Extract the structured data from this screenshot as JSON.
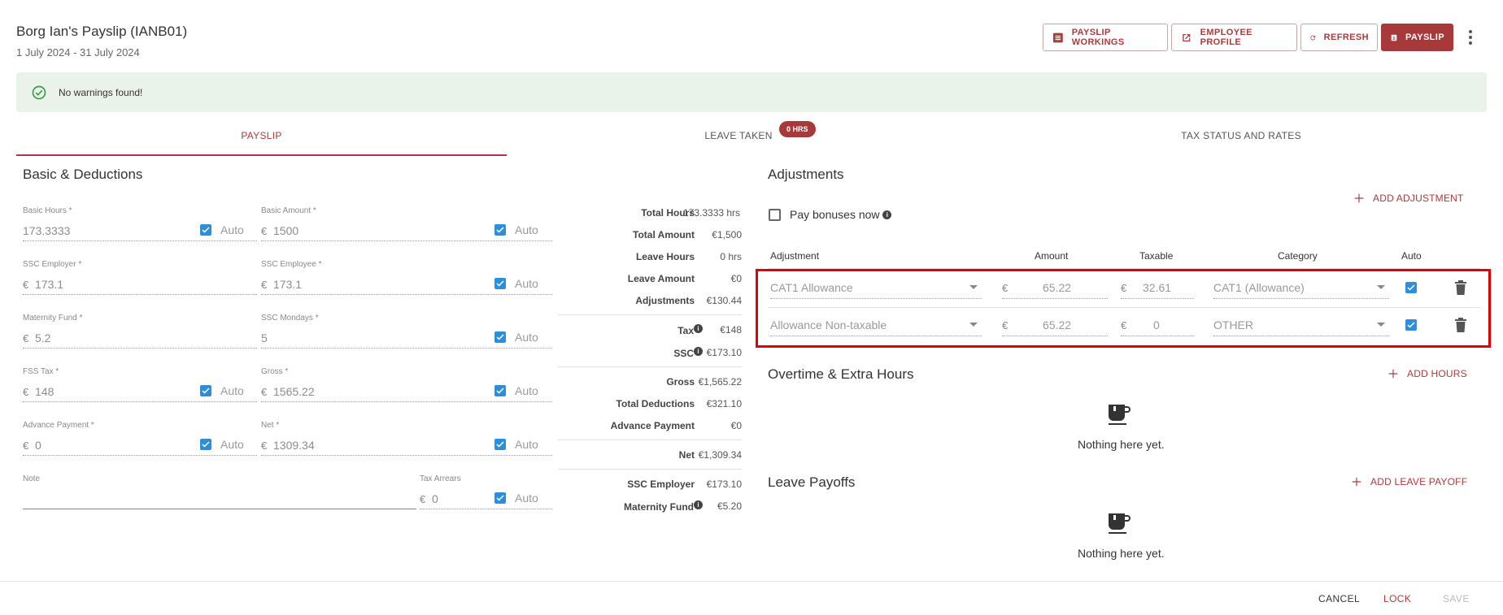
{
  "header": {
    "title": "Borg Ian's Payslip (IANB01)",
    "period": "1 July 2024 - 31 July 2024",
    "buttons": {
      "payslip_workings": "PAYSLIP WORKINGS",
      "employee_profile": "EMPLOYEE PROFILE",
      "refresh": "REFRESH",
      "payslip": "PAYSLIP"
    }
  },
  "banner": {
    "text": "No warnings found!"
  },
  "tabs": [
    {
      "label": "PAYSLIP",
      "active": true
    },
    {
      "label": "LEAVE TAKEN",
      "badge": "0 HRS"
    },
    {
      "label": "TAX STATUS AND RATES"
    }
  ],
  "basic": {
    "title": "Basic & Deductions",
    "auto_label": "Auto",
    "currency": "€",
    "fields": {
      "basic_hours": {
        "label": "Basic Hours *",
        "value": "173.3333"
      },
      "basic_amount": {
        "label": "Basic Amount *",
        "value": "1500"
      },
      "ssc_employer": {
        "label": "SSC Employer *",
        "value": "173.1"
      },
      "ssc_employee": {
        "label": "SSC Employee *",
        "value": "173.1"
      },
      "maternity_fund": {
        "label": "Maternity Fund *",
        "value": "5.2"
      },
      "ssc_mondays": {
        "label": "SSC Mondays *",
        "value": "5"
      },
      "fss_tax": {
        "label": "FSS Tax *",
        "value": "148"
      },
      "gross": {
        "label": "Gross *",
        "value": "1565.22"
      },
      "advance_payment": {
        "label": "Advance Payment *",
        "value": "0"
      },
      "net": {
        "label": "Net *",
        "value": "1309.34"
      },
      "note": {
        "label": "Note",
        "value": ""
      },
      "tax_arrears": {
        "label": "Tax Arrears",
        "value": "0"
      }
    }
  },
  "summary": {
    "total_hours": {
      "label": "Total Hours",
      "value": "173.3333 hrs"
    },
    "total_amount": {
      "label": "Total Amount",
      "value": "€1,500"
    },
    "leave_hours": {
      "label": "Leave Hours",
      "value": "0 hrs"
    },
    "leave_amount": {
      "label": "Leave Amount",
      "value": "€0"
    },
    "adjustments": {
      "label": "Adjustments",
      "value": "€130.44"
    },
    "tax": {
      "label": "Tax",
      "value": "€148"
    },
    "ssc": {
      "label": "SSC",
      "value": "€173.10"
    },
    "gross": {
      "label": "Gross",
      "value": "€1,565.22"
    },
    "total_deductions": {
      "label": "Total Deductions",
      "value": "€321.10"
    },
    "advance_payment": {
      "label": "Advance Payment",
      "value": "€0"
    },
    "net": {
      "label": "Net",
      "value": "€1,309.34"
    },
    "ssc_employer": {
      "label": "SSC Employer",
      "value": "€173.10"
    },
    "maternity_fund": {
      "label": "Maternity Fund",
      "value": "€5.20"
    }
  },
  "adjustments": {
    "title": "Adjustments",
    "pay_bonuses_label": "Pay bonuses now",
    "add_label": "ADD ADJUSTMENT",
    "columns": {
      "adjustment": "Adjustment",
      "amount": "Amount",
      "taxable": "Taxable",
      "category": "Category",
      "auto": "Auto"
    },
    "currency": "€",
    "rows": [
      {
        "name": "CAT1 Allowance",
        "amount": "65.22",
        "taxable": "32.61",
        "category": "CAT1 (Allowance)"
      },
      {
        "name": "Allowance Non-taxable",
        "amount": "65.22",
        "taxable": "0",
        "category": "OTHER"
      }
    ]
  },
  "overtime": {
    "title": "Overtime & Extra Hours",
    "add_label": "ADD HOURS",
    "empty_text": "Nothing here yet."
  },
  "leave_payoffs": {
    "title": "Leave Payoffs",
    "add_label": "ADD LEAVE PAYOFF",
    "empty_text": "Nothing here yet."
  },
  "footer": {
    "cancel": "CANCEL",
    "lock": "LOCK",
    "save": "SAVE"
  },
  "colors": {
    "accent": "#a8393a",
    "checkbox": "#2e8fd8",
    "banner_bg": "#eaf3ea",
    "success": "#3a9a4a",
    "highlight": "#e00000"
  }
}
